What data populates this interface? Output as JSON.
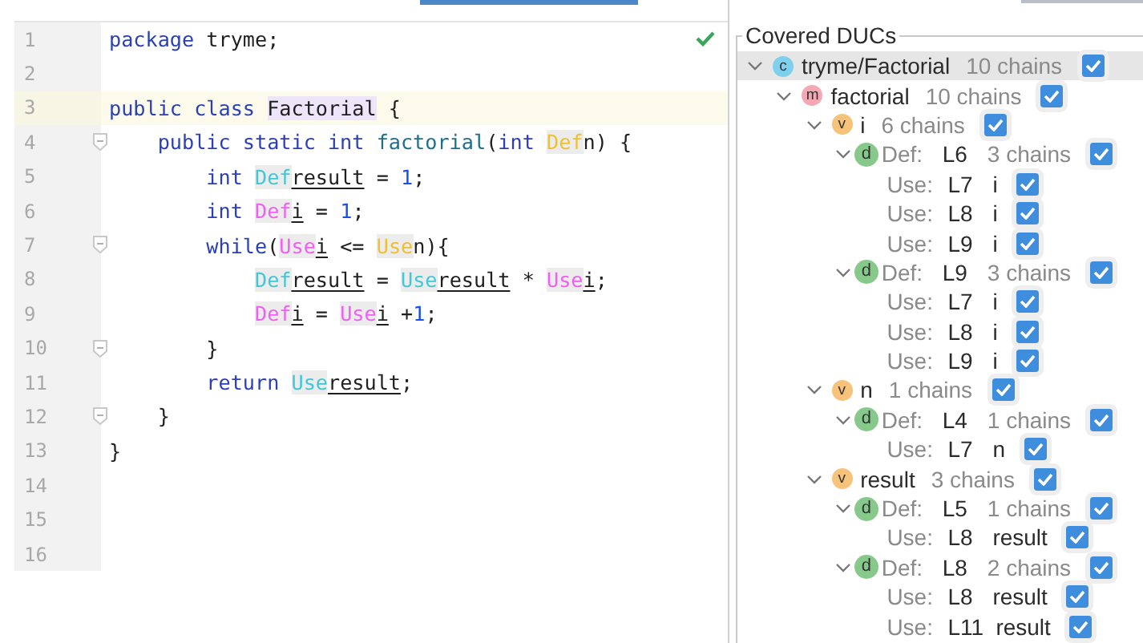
{
  "editor": {
    "status_ok": true,
    "lines": [
      {
        "number": "1",
        "current": false,
        "fold": false,
        "tokens": [
          {
            "kind": "kw",
            "text": "package"
          },
          {
            "kind": "plain",
            "text": " tryme;"
          }
        ]
      },
      {
        "number": "2",
        "current": false,
        "fold": false
      },
      {
        "number": "3",
        "current": true,
        "fold": false,
        "tokens": [
          {
            "kind": "kw",
            "text": "public class "
          },
          {
            "kind": "cls",
            "text": "Factorial"
          },
          {
            "kind": "plain",
            "text": " {"
          }
        ],
        "children": [
          {
            "number": "4",
            "current": false,
            "fold": true,
            "tokens": [
              {
                "kind": "kw",
                "text": "public static int "
              },
              {
                "kind": "fn",
                "text": "factorial"
              },
              {
                "kind": "plain",
                "text": "("
              },
              {
                "kind": "kw",
                "text": "int "
              },
              {
                "kind": "tag",
                "text": "Def",
                "color": "#f0c030"
              },
              {
                "kind": "plain",
                "text": "n) {"
              }
            ],
            "children": [
              {
                "number": "5",
                "current": false,
                "fold": false,
                "tokens": [
                  {
                    "kind": "kw",
                    "text": "int "
                  },
                  {
                    "kind": "tag",
                    "text": "Def",
                    "color": "#40c8d8"
                  },
                  {
                    "kind": "var",
                    "text": "result"
                  },
                  {
                    "kind": "plain",
                    "text": " = "
                  },
                  {
                    "kind": "num",
                    "text": "1"
                  },
                  {
                    "kind": "plain",
                    "text": ";"
                  }
                ]
              },
              {
                "number": "6",
                "current": false,
                "fold": false,
                "tokens": [
                  {
                    "kind": "kw",
                    "text": "int "
                  },
                  {
                    "kind": "tag",
                    "text": "Def",
                    "color": "#f060f0"
                  },
                  {
                    "kind": "var",
                    "text": "i"
                  },
                  {
                    "kind": "plain",
                    "text": " = "
                  },
                  {
                    "kind": "num",
                    "text": "1"
                  },
                  {
                    "kind": "plain",
                    "text": ";"
                  }
                ]
              },
              {
                "number": "7",
                "current": false,
                "fold": true,
                "tokens": [
                  {
                    "kind": "kw",
                    "text": "while"
                  },
                  {
                    "kind": "plain",
                    "text": "("
                  },
                  {
                    "kind": "tag",
                    "text": "Use",
                    "color": "#f060f0"
                  },
                  {
                    "kind": "var",
                    "text": "i"
                  },
                  {
                    "kind": "plain",
                    "text": " <= "
                  },
                  {
                    "kind": "tag",
                    "text": "Use",
                    "color": "#f0c030"
                  },
                  {
                    "kind": "plain",
                    "text": "n){"
                  }
                ],
                "children": [
                  {
                    "number": "8",
                    "current": false,
                    "fold": false,
                    "tokens": [
                      {
                        "kind": "tag",
                        "text": "Def",
                        "color": "#40c8d8"
                      },
                      {
                        "kind": "var",
                        "text": "result"
                      },
                      {
                        "kind": "plain",
                        "text": " = "
                      },
                      {
                        "kind": "tag",
                        "text": "Use",
                        "color": "#40c8d8"
                      },
                      {
                        "kind": "var",
                        "text": "result"
                      },
                      {
                        "kind": "plain",
                        "text": " * "
                      },
                      {
                        "kind": "tag",
                        "text": "Use",
                        "color": "#f060f0"
                      },
                      {
                        "kind": "var",
                        "text": "i"
                      },
                      {
                        "kind": "plain",
                        "text": ";"
                      }
                    ]
                  },
                  {
                    "number": "9",
                    "current": false,
                    "fold": false,
                    "tokens": [
                      {
                        "kind": "tag",
                        "text": "Def",
                        "color": "#f060f0"
                      },
                      {
                        "kind": "var",
                        "text": "i"
                      },
                      {
                        "kind": "plain",
                        "text": " = "
                      },
                      {
                        "kind": "tag",
                        "text": "Use",
                        "color": "#f060f0"
                      },
                      {
                        "kind": "var",
                        "text": "i"
                      },
                      {
                        "kind": "plain",
                        "text": " +"
                      },
                      {
                        "kind": "num",
                        "text": "1"
                      },
                      {
                        "kind": "plain",
                        "text": ";"
                      }
                    ]
                  }
                ]
              },
              {
                "number": "10",
                "current": false,
                "fold": true,
                "tokens": [
                  {
                    "kind": "plain",
                    "text": "}"
                  }
                ]
              },
              {
                "number": "11",
                "current": false,
                "fold": false,
                "tokens": [
                  {
                    "kind": "kw",
                    "text": "return "
                  },
                  {
                    "kind": "tag",
                    "text": "Use",
                    "color": "#40c8d8"
                  },
                  {
                    "kind": "var",
                    "text": "result"
                  },
                  {
                    "kind": "plain",
                    "text": ";"
                  }
                ]
              }
            ]
          },
          {
            "number": "12",
            "current": false,
            "fold": true,
            "tokens": [
              {
                "kind": "plain",
                "text": "}"
              }
            ]
          }
        ]
      },
      {
        "number": "13",
        "current": false,
        "fold": false,
        "tokens": [
          {
            "kind": "plain",
            "text": "}"
          }
        ]
      },
      {
        "number": "14",
        "current": false,
        "fold": false
      },
      {
        "number": "15",
        "current": false,
        "fold": false
      },
      {
        "number": "16",
        "current": false,
        "fold": false
      }
    ]
  },
  "panel": {
    "title": "Covered DUCs",
    "tree": [
      {
        "kind": "class",
        "badge": "c",
        "name": "tryme/Factorial",
        "count": "10 chains",
        "expanded": true,
        "checked": true,
        "selected": true,
        "children": [
          {
            "kind": "method",
            "badge": "m",
            "name": "factorial",
            "count": "10 chains",
            "expanded": true,
            "checked": true,
            "selected": false,
            "children": [
              {
                "kind": "var",
                "badge": "v",
                "name": "i",
                "count": "6 chains",
                "expanded": true,
                "checked": true,
                "selected": false,
                "children": [
                  {
                    "kind": "def",
                    "badge": "d",
                    "label": "Def:",
                    "line": "L6",
                    "count": "3 chains",
                    "expanded": true,
                    "checked": true,
                    "selected": false,
                    "children": [
                      {
                        "kind": "use",
                        "label": "Use:",
                        "line": "L7",
                        "name": "i",
                        "checked": true,
                        "selected": false
                      },
                      {
                        "kind": "use",
                        "label": "Use:",
                        "line": "L8",
                        "name": "i",
                        "checked": true,
                        "selected": false
                      },
                      {
                        "kind": "use",
                        "label": "Use:",
                        "line": "L9",
                        "name": "i",
                        "checked": true,
                        "selected": false
                      }
                    ]
                  },
                  {
                    "kind": "def",
                    "badge": "d",
                    "label": "Def:",
                    "line": "L9",
                    "count": "3 chains",
                    "expanded": true,
                    "checked": true,
                    "selected": false,
                    "children": [
                      {
                        "kind": "use",
                        "label": "Use:",
                        "line": "L7",
                        "name": "i",
                        "checked": true,
                        "selected": false
                      },
                      {
                        "kind": "use",
                        "label": "Use:",
                        "line": "L8",
                        "name": "i",
                        "checked": true,
                        "selected": false
                      },
                      {
                        "kind": "use",
                        "label": "Use:",
                        "line": "L9",
                        "name": "i",
                        "checked": true,
                        "selected": false
                      }
                    ]
                  }
                ]
              },
              {
                "kind": "var",
                "badge": "v",
                "name": "n",
                "count": "1 chains",
                "expanded": true,
                "checked": true,
                "selected": false,
                "children": [
                  {
                    "kind": "def",
                    "badge": "d",
                    "label": "Def:",
                    "line": "L4",
                    "count": "1 chains",
                    "expanded": true,
                    "checked": true,
                    "selected": false,
                    "children": [
                      {
                        "kind": "use",
                        "label": "Use:",
                        "line": "L7",
                        "name": "n",
                        "checked": true,
                        "selected": false
                      }
                    ]
                  }
                ]
              },
              {
                "kind": "var",
                "badge": "v",
                "name": "result",
                "count": "3 chains",
                "expanded": true,
                "checked": true,
                "selected": false,
                "children": [
                  {
                    "kind": "def",
                    "badge": "d",
                    "label": "Def:",
                    "line": "L5",
                    "count": "1 chains",
                    "expanded": true,
                    "checked": true,
                    "selected": false,
                    "children": [
                      {
                        "kind": "use",
                        "label": "Use:",
                        "line": "L8",
                        "name": "result",
                        "checked": true,
                        "selected": false
                      }
                    ]
                  },
                  {
                    "kind": "def",
                    "badge": "d",
                    "label": "Def:",
                    "line": "L8",
                    "count": "2 chains",
                    "expanded": true,
                    "checked": true,
                    "selected": false,
                    "children": [
                      {
                        "kind": "use",
                        "label": "Use:",
                        "line": "L8",
                        "name": "result",
                        "checked": true,
                        "selected": false
                      },
                      {
                        "kind": "use",
                        "label": "Use:",
                        "line": "L11",
                        "name": "result",
                        "checked": true,
                        "selected": false
                      }
                    ]
                  }
                ]
              }
            ]
          }
        ]
      }
    ]
  }
}
